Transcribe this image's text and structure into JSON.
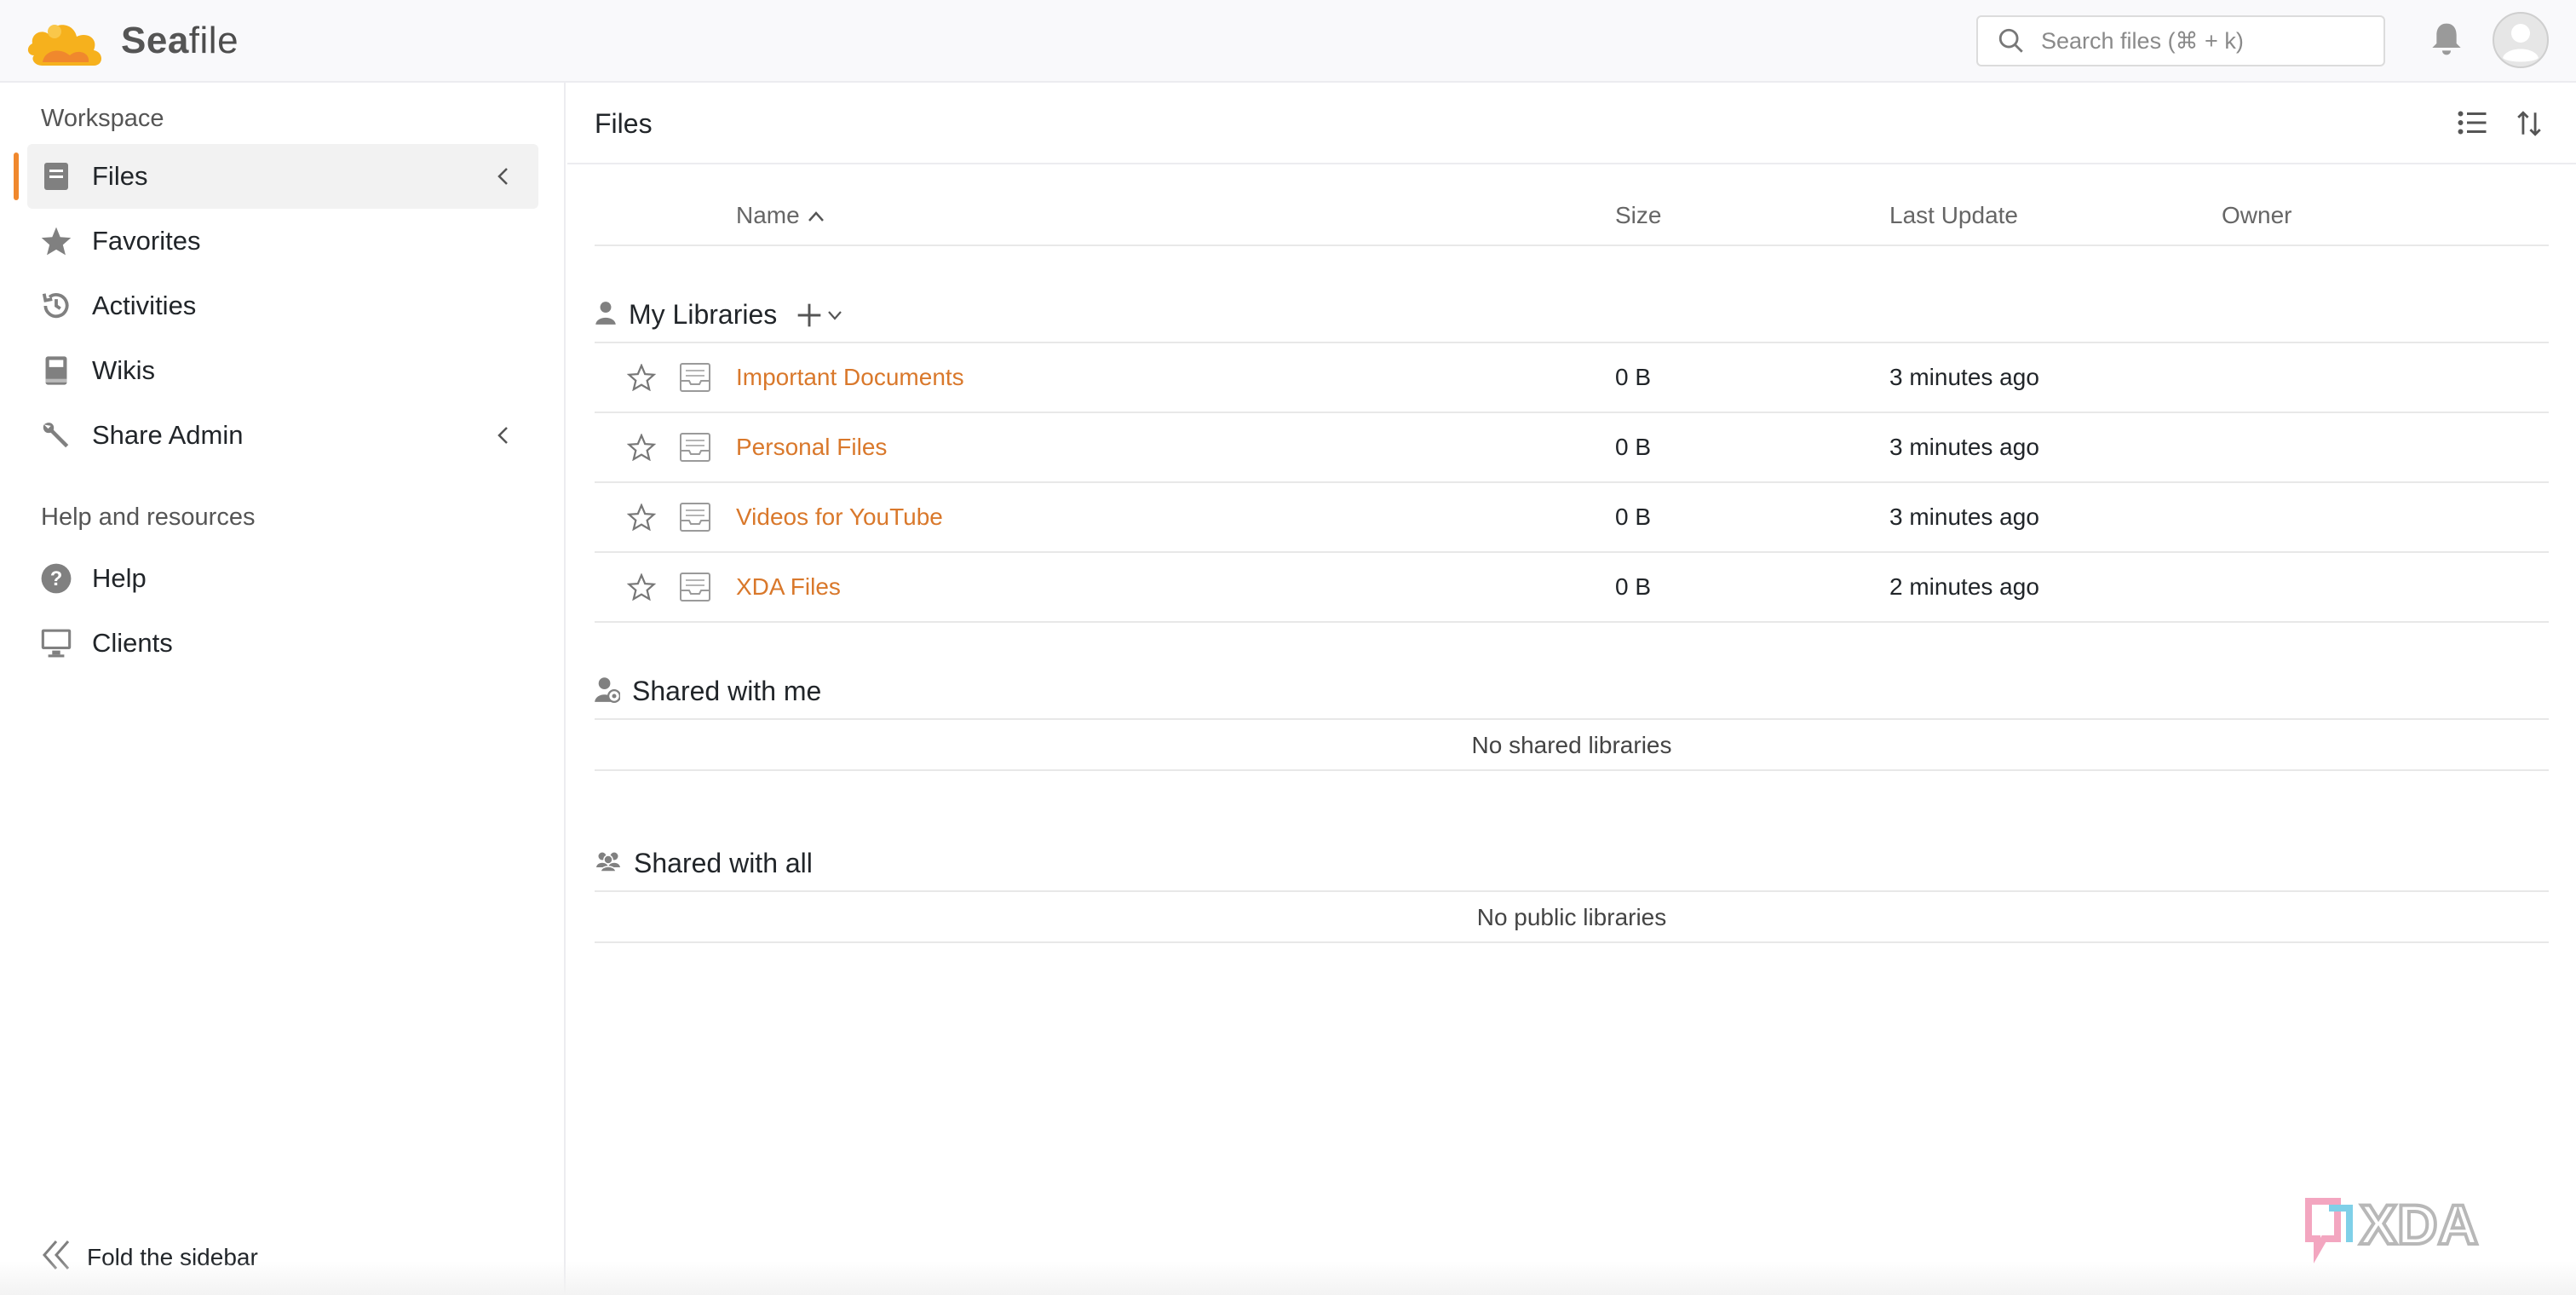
{
  "app": {
    "brand_prefix": "Sea",
    "brand_suffix": "file"
  },
  "topbar": {
    "search_placeholder": "Search files (⌘ + k)"
  },
  "sidebar": {
    "workspace_heading": "Workspace",
    "items": [
      {
        "label": "Files",
        "icon": "file-icon",
        "active": true
      },
      {
        "label": "Favorites",
        "icon": "star-icon"
      },
      {
        "label": "Activities",
        "icon": "history-icon"
      },
      {
        "label": "Wikis",
        "icon": "book-icon"
      },
      {
        "label": "Share Admin",
        "icon": "wrench-icon"
      }
    ],
    "help_heading": "Help and resources",
    "help_items": [
      {
        "label": "Help",
        "icon": "question-icon"
      },
      {
        "label": "Clients",
        "icon": "monitor-icon"
      }
    ],
    "fold_label": "Fold the sidebar"
  },
  "main": {
    "title": "Files",
    "columns": {
      "name": "Name",
      "size": "Size",
      "last_update": "Last Update",
      "owner": "Owner"
    },
    "my_libraries": {
      "title": "My Libraries",
      "rows": [
        {
          "name": "Important Documents",
          "size": "0 B",
          "updated": "3 minutes ago"
        },
        {
          "name": "Personal Files",
          "size": "0 B",
          "updated": "3 minutes ago"
        },
        {
          "name": "Videos for YouTube",
          "size": "0 B",
          "updated": "3 minutes ago"
        },
        {
          "name": "XDA Files",
          "size": "0 B",
          "updated": "2 minutes ago"
        }
      ]
    },
    "shared_with_me": {
      "title": "Shared with me",
      "empty": "No shared libraries"
    },
    "shared_with_all": {
      "title": "Shared with all",
      "empty": "No public libraries"
    }
  },
  "watermark": "XDA",
  "colors": {
    "accent": "#f0882d",
    "link": "#d9782b",
    "logo_yellow": "#f6b11d"
  }
}
